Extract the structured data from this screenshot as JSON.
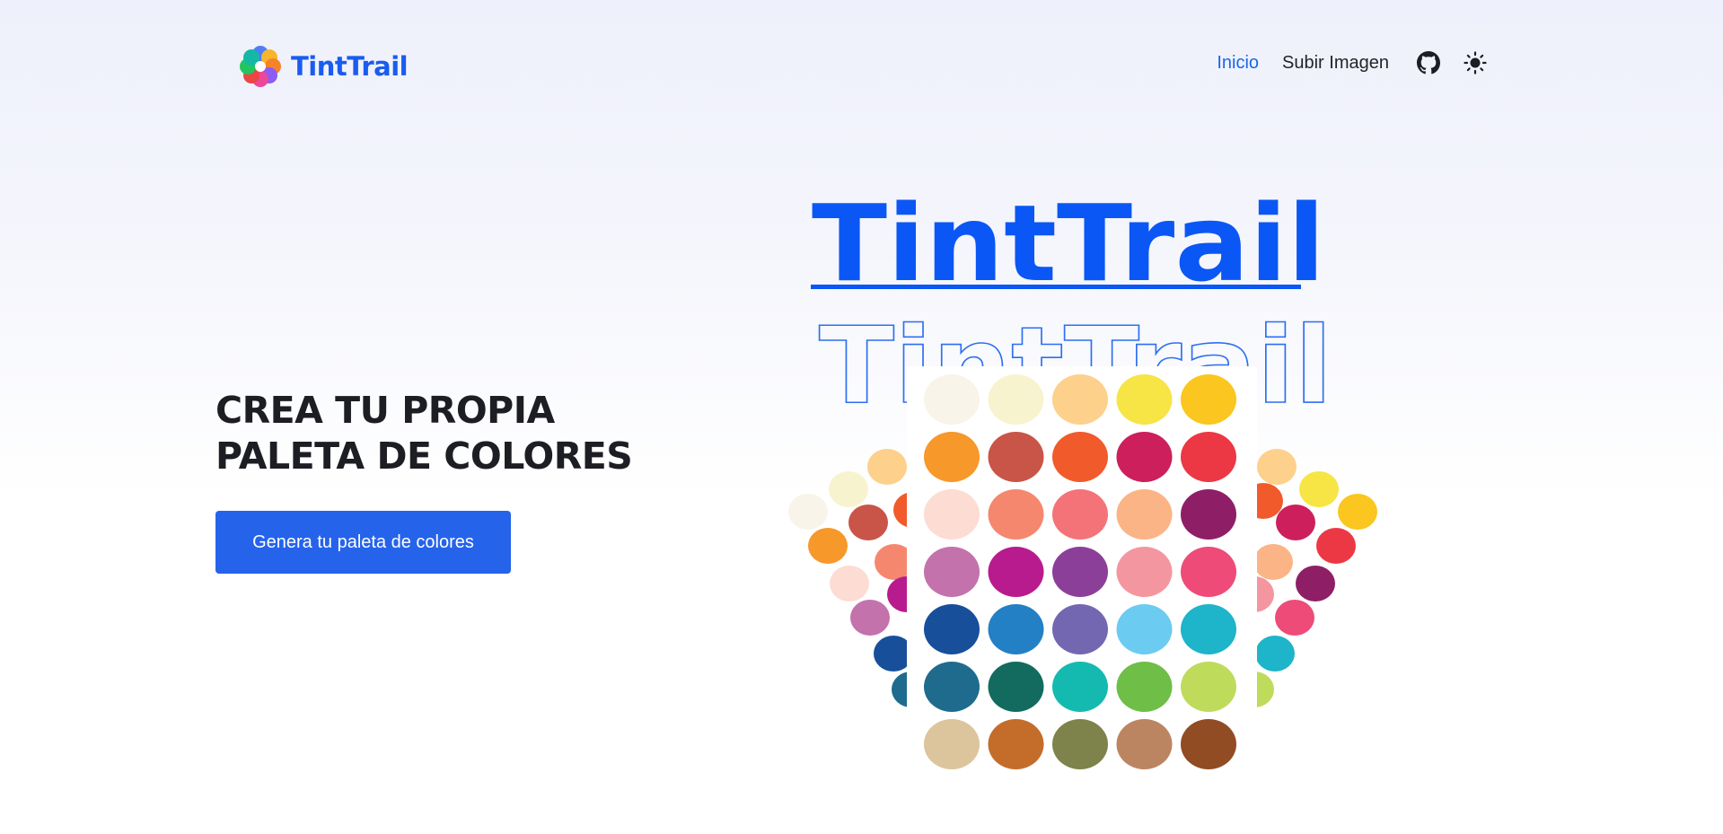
{
  "brand": {
    "name": "TintTrail",
    "color": "#1a5cf0"
  },
  "nav": {
    "links": [
      {
        "label": "Inicio",
        "active": true
      },
      {
        "label": "Subir Imagen",
        "active": false
      }
    ],
    "icons": [
      "github-icon",
      "sun-icon"
    ]
  },
  "hero": {
    "title_line1": "CREA TU PROPIA",
    "title_line2": "PALETA DE COLORES",
    "cta_label": "Genera tu paleta de colores"
  },
  "illustration": {
    "wordmark": "TintTrail",
    "wordmark_outline": "TintTrail",
    "palette": [
      [
        "#f8f4ea",
        "#f8f3cf",
        "#fdd08b",
        "#f6e544",
        "#fac61f"
      ],
      [
        "#f6982a",
        "#c95448",
        "#f15a2b",
        "#cc1f5b",
        "#ec3845"
      ],
      [
        "#fcdcd3",
        "#f5876f",
        "#f47378",
        "#fbb486",
        "#8e1f66"
      ],
      [
        "#c372ac",
        "#b81b8d",
        "#8b3f99",
        "#f496a0",
        "#ee4b78"
      ],
      [
        "#174f9b",
        "#2480c4",
        "#7467b1",
        "#6ccbf1",
        "#1eb4c9"
      ],
      [
        "#1f6b8e",
        "#136b5f",
        "#14bab0",
        "#6ebe48",
        "#bfdb5c"
      ],
      [
        "#dcc49c",
        "#c46d2a",
        "#7d834a",
        "#bc8561",
        "#914c24"
      ]
    ],
    "side_left": [
      "#f8f4ea",
      "#f8f3cf",
      "#fdd08b",
      "#c95448",
      "#f6982a",
      "#f5876f",
      "#fcdcd3",
      "#b81b8d",
      "#c372ac",
      "#174f9b",
      "#1f6b8e",
      "#f15a2b"
    ],
    "side_right": [
      "#fdd08b",
      "#f6e544",
      "#fac61f",
      "#cc1f5b",
      "#ec3845",
      "#fbb486",
      "#8e1f66",
      "#f496a0",
      "#ee4b78",
      "#1eb4c9",
      "#bfdb5c",
      "#f15a2b"
    ]
  }
}
